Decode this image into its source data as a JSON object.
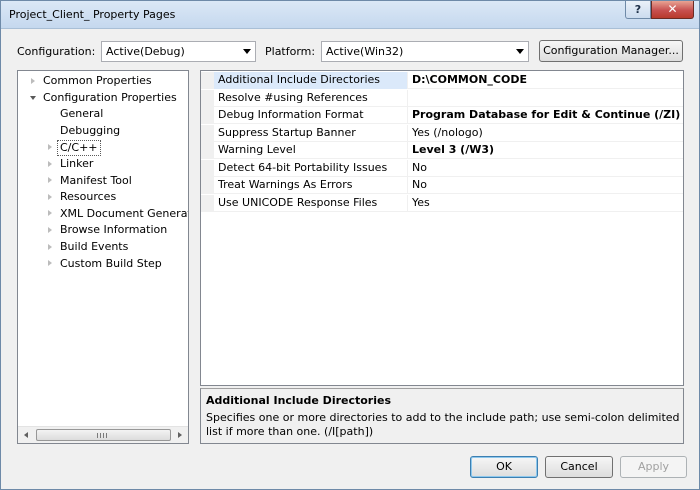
{
  "window": {
    "title": "Project_Client_ Property Pages",
    "help_label": "?",
    "close_label": "✕"
  },
  "toolbar": {
    "configuration_label": "Configuration:",
    "configuration_value": "Active(Debug)",
    "platform_label": "Platform:",
    "platform_value": "Active(Win32)",
    "config_manager_label": "Configuration Manager..."
  },
  "tree": {
    "items": [
      {
        "label": "Common Properties",
        "expander": "closed",
        "level": 0
      },
      {
        "label": "Configuration Properties",
        "expander": "open",
        "level": 0
      },
      {
        "label": "General",
        "expander": "none",
        "level": 1
      },
      {
        "label": "Debugging",
        "expander": "none",
        "level": 1
      },
      {
        "label": "C/C++",
        "expander": "closed",
        "level": 1,
        "selected": true
      },
      {
        "label": "Linker",
        "expander": "closed",
        "level": 1
      },
      {
        "label": "Manifest Tool",
        "expander": "closed",
        "level": 1
      },
      {
        "label": "Resources",
        "expander": "closed",
        "level": 1
      },
      {
        "label": "XML Document Generator",
        "expander": "closed",
        "level": 1
      },
      {
        "label": "Browse Information",
        "expander": "closed",
        "level": 1
      },
      {
        "label": "Build Events",
        "expander": "closed",
        "level": 1
      },
      {
        "label": "Custom Build Step",
        "expander": "closed",
        "level": 1
      }
    ]
  },
  "grid": {
    "rows": [
      {
        "name": "Additional Include Directories",
        "value": "D:\\COMMON_CODE",
        "bold": true,
        "selected": true
      },
      {
        "name": "Resolve #using References",
        "value": "",
        "bold": false
      },
      {
        "name": "Debug Information Format",
        "value": "Program Database for Edit & Continue (/ZI)",
        "bold": true
      },
      {
        "name": "Suppress Startup Banner",
        "value": "Yes (/nologo)",
        "bold": false
      },
      {
        "name": "Warning Level",
        "value": "Level 3 (/W3)",
        "bold": true
      },
      {
        "name": "Detect 64-bit Portability Issues",
        "value": "No",
        "bold": false
      },
      {
        "name": "Treat Warnings As Errors",
        "value": "No",
        "bold": false
      },
      {
        "name": "Use UNICODE Response Files",
        "value": "Yes",
        "bold": false
      }
    ]
  },
  "description": {
    "title": "Additional Include Directories",
    "text": "Specifies one or more directories to add to the include path; use semi-colon delimited list if more than one.     (/I[path])"
  },
  "buttons": {
    "ok": "OK",
    "cancel": "Cancel",
    "apply": "Apply"
  }
}
